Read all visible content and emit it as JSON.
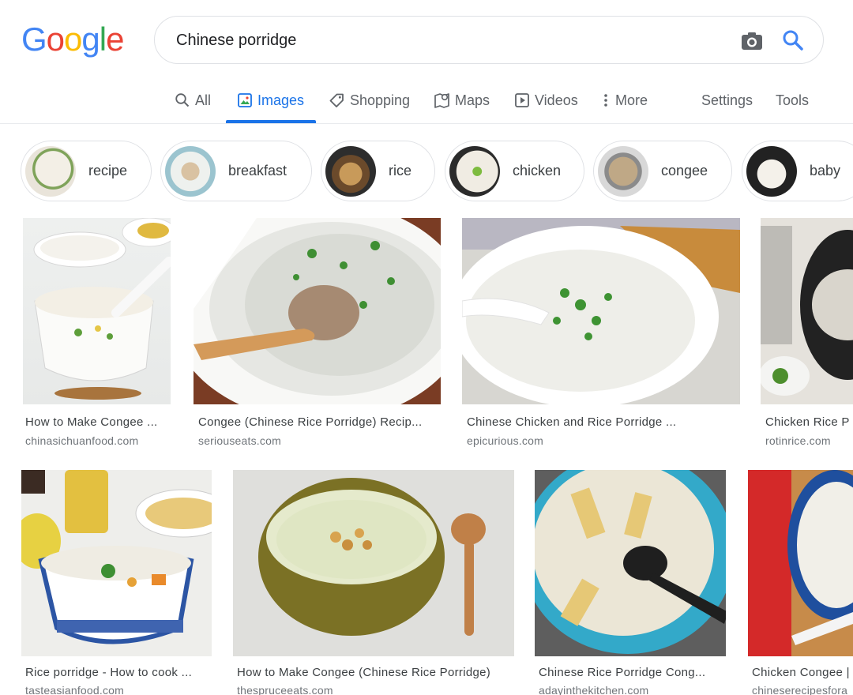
{
  "logo": {
    "letters": [
      "G",
      "o",
      "o",
      "g",
      "l",
      "e"
    ],
    "colors": [
      "#4285F4",
      "#EA4335",
      "#FBBC05",
      "#4285F4",
      "#34A853",
      "#EA4335"
    ]
  },
  "search": {
    "query": "Chinese porridge"
  },
  "tabs": [
    {
      "label": "All",
      "icon": "search-icon"
    },
    {
      "label": "Images",
      "icon": "image-icon",
      "active": true
    },
    {
      "label": "Shopping",
      "icon": "tag-icon"
    },
    {
      "label": "Maps",
      "icon": "map-icon"
    },
    {
      "label": "Videos",
      "icon": "play-icon"
    },
    {
      "label": "More",
      "icon": "more-vertical-icon"
    }
  ],
  "tools": {
    "settings": "Settings",
    "tools": "Tools"
  },
  "chips": [
    {
      "label": "recipe"
    },
    {
      "label": "breakfast"
    },
    {
      "label": "rice"
    },
    {
      "label": "chicken"
    },
    {
      "label": "congee"
    },
    {
      "label": "baby"
    }
  ],
  "results": [
    {
      "title": "How to Make Congee ...",
      "domain": "chinasichuanfood.com"
    },
    {
      "title": "Congee (Chinese Rice Porridge) Recip...",
      "domain": "seriouseats.com"
    },
    {
      "title": "Chinese Chicken and Rice Porridge ...",
      "domain": "epicurious.com"
    },
    {
      "title": "Chicken Rice P",
      "domain": "rotinrice.com"
    },
    {
      "title": "Rice porridge - How to cook ...",
      "domain": "tasteasianfood.com"
    },
    {
      "title": "How to Make Congee (Chinese Rice Porridge)",
      "domain": "thespruceeats.com"
    },
    {
      "title": "Chinese Rice Porridge Cong...",
      "domain": "adayinthekitchen.com"
    },
    {
      "title": "Chicken Congee |",
      "domain": "chineserecipesfora"
    }
  ],
  "accent": "#1a73e8"
}
